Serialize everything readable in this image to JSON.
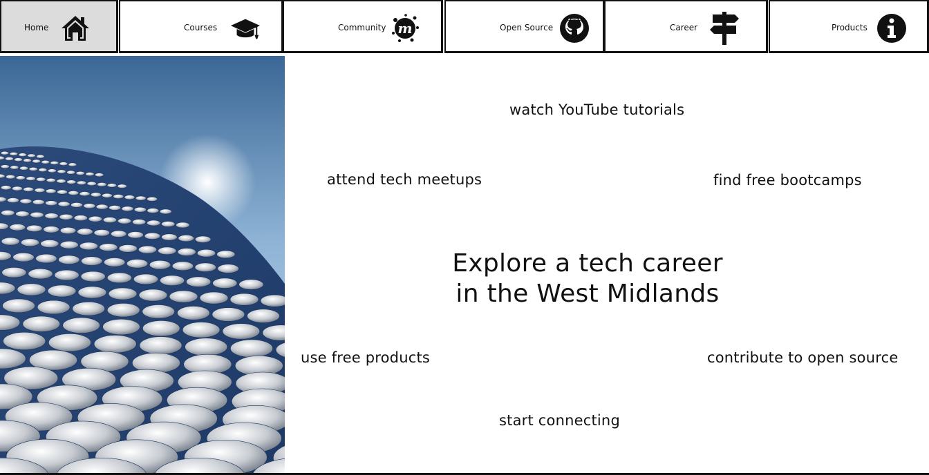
{
  "nav": {
    "tabs": [
      {
        "label": "Home",
        "icon": "house-icon",
        "active": true
      },
      {
        "label": "Courses",
        "icon": "graduation-cap-icon",
        "active": false
      },
      {
        "label": "Community",
        "icon": "meetup-icon",
        "active": false
      },
      {
        "label": "Open Source",
        "icon": "github-icon",
        "active": false
      },
      {
        "label": "Career",
        "icon": "signpost-icon",
        "active": false
      },
      {
        "label": "Products",
        "icon": "info-icon",
        "active": false
      }
    ]
  },
  "hero": {
    "image": "building-facade-discs-sky",
    "headline_line1": "Explore a tech career",
    "headline_line2": "in the West Midlands"
  },
  "activities": {
    "youtube": "watch YouTube tutorials",
    "meetups": "attend tech meetups",
    "bootcamps": "find free bootcamps",
    "products": "use free products",
    "open_source": "contribute to open source",
    "connecting": "start connecting"
  },
  "colors": {
    "active_tab": "#dcdcdc",
    "border": "#111111",
    "sky_top": "#3d6a9a",
    "sky_bottom": "#c9dcec"
  }
}
